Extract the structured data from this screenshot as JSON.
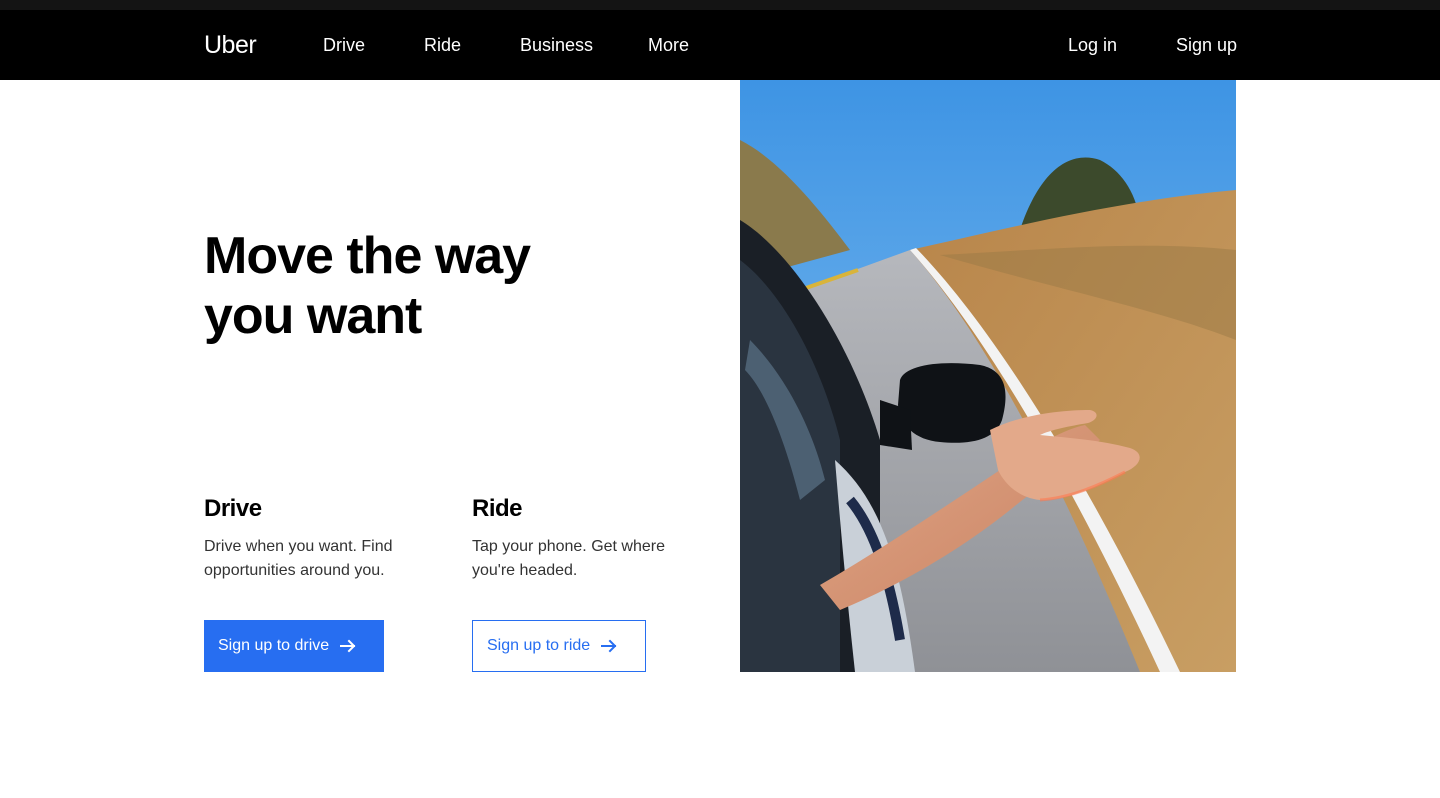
{
  "brand": {
    "logo_text": "Uber",
    "accent_color": "#276ef1",
    "nav_background": "#000000"
  },
  "nav": {
    "items": [
      {
        "label": "Drive"
      },
      {
        "label": "Ride"
      },
      {
        "label": "Business"
      },
      {
        "label": "More"
      }
    ],
    "login_label": "Log in",
    "signup_label": "Sign up"
  },
  "hero": {
    "title_line1": "Move the way",
    "title_line2": "you want",
    "image_description": "hand-out-car-window-icon"
  },
  "columns": {
    "drive": {
      "heading": "Drive",
      "text": "Drive when you want. Find opportunities around you.",
      "button_label": "Sign up to drive",
      "button_icon": "arrow-right-icon"
    },
    "ride": {
      "heading": "Ride",
      "text": "Tap your phone. Get where you're headed.",
      "button_label": "Sign up to ride",
      "button_icon": "arrow-right-icon"
    }
  }
}
